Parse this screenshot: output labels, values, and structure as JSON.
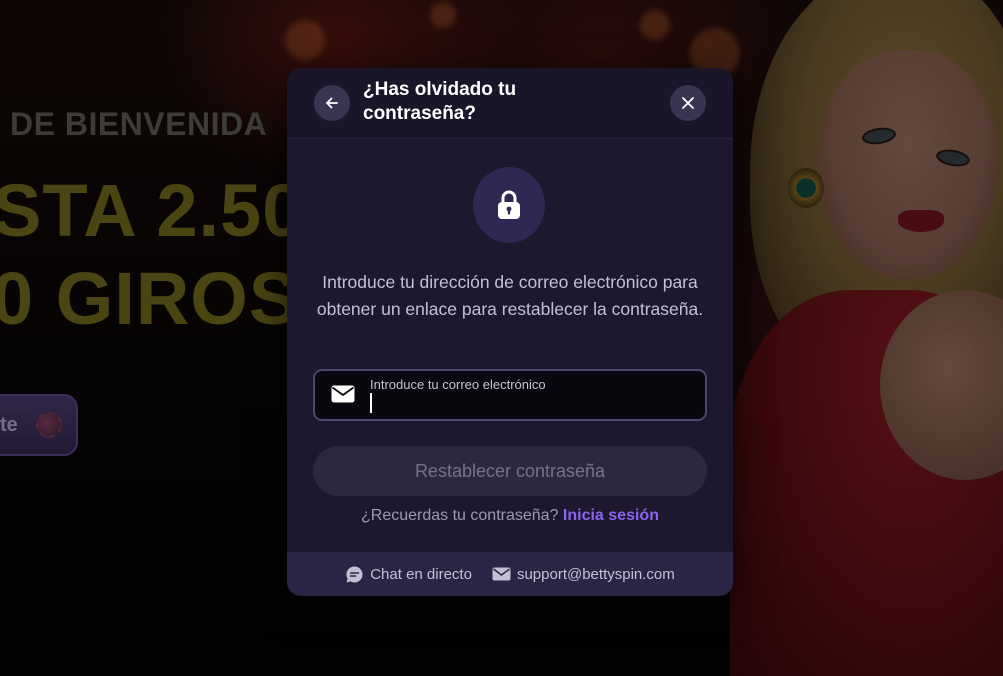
{
  "background": {
    "hero_line_1": "DE BIENVENIDA",
    "hero_line_2": "STA 2.50",
    "hero_line_3": "0 GIROS",
    "hero_button_label": "te"
  },
  "modal": {
    "title": "¿Has olvidado tu contraseña?",
    "back_icon": "arrow-left-icon",
    "close_icon": "close-icon",
    "lock_icon": "lock-icon",
    "description": "Introduce tu dirección de correo electrónico para obtener un enlace para restablecer la contraseña.",
    "email": {
      "label": "Introduce tu correo electrónico",
      "value": "",
      "icon": "envelope-icon"
    },
    "submit_label": "Restablecer contraseña",
    "remember_text": "¿Recuerdas tu contraseña?",
    "login_link": "Inicia sesión",
    "footer": {
      "chat_label": "Chat en directo",
      "chat_icon": "chat-bubble-icon",
      "support_email": "support@bettyspin.com",
      "support_icon": "envelope-icon"
    }
  },
  "colors": {
    "modal_bg": "#1d182e",
    "accent_link": "#8a63f0",
    "footer_bg": "#2a2445",
    "lock_circle": "#2f2852"
  }
}
